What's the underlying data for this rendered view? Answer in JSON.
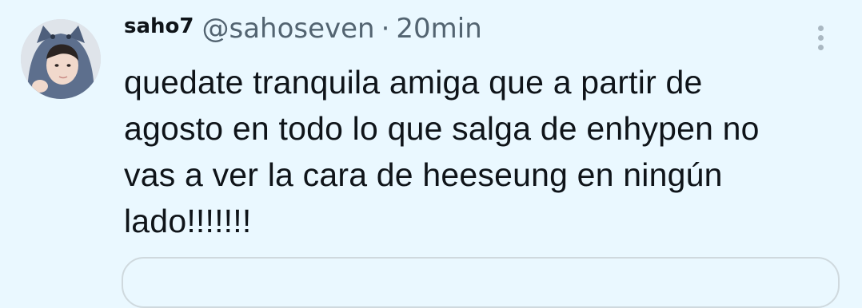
{
  "tweet": {
    "display_name": "saho7",
    "handle": "@sahoseven",
    "separator": "·",
    "time": "20min",
    "text": "quedate tranquila amiga que a partir de\nagosto en todo lo que salga de enhypen no\nvas a ver la cara de heeseung en ningún\nlado!!!!!!!",
    "more_icon": "more-vertical-icon",
    "avatar": "avatar"
  },
  "colors": {
    "background": "#eaf8ff",
    "text_primary": "#0f1419",
    "text_secondary": "#536471",
    "border": "#cfd9de"
  }
}
